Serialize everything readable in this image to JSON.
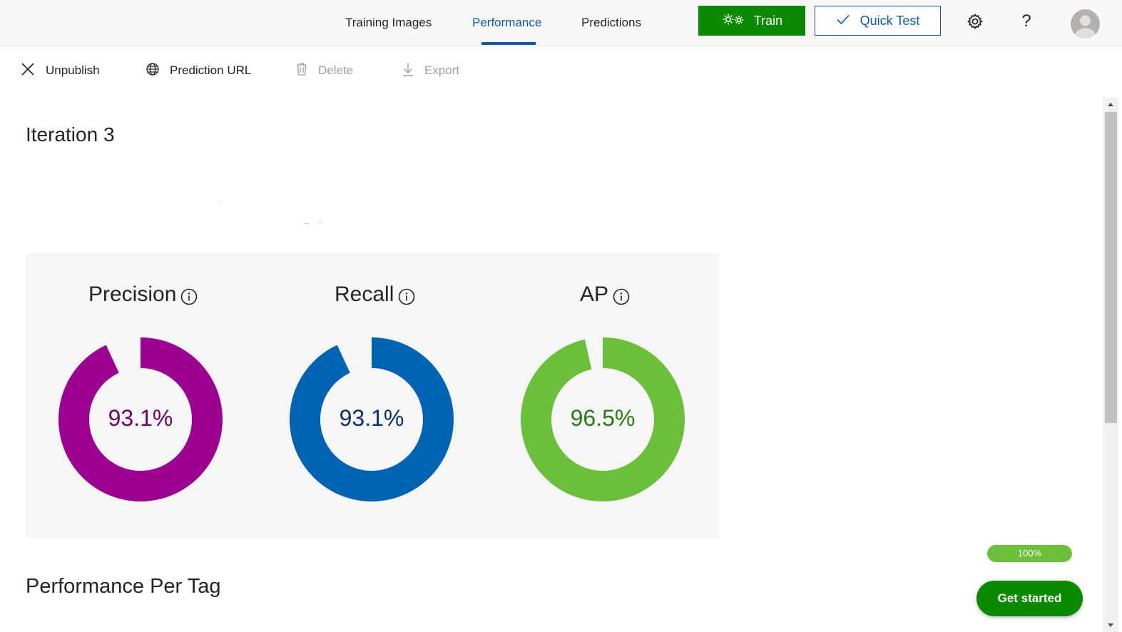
{
  "nav": {
    "tabs": [
      {
        "label": "Training Images"
      },
      {
        "label": "Performance",
        "active": true
      },
      {
        "label": "Predictions"
      }
    ],
    "train_label": "Train",
    "quick_test_label": "Quick Test",
    "help_label": "?"
  },
  "commands": {
    "unpublish": "Unpublish",
    "prediction_url": "Prediction URL",
    "delete": "Delete",
    "export": "Export"
  },
  "iteration_title": "Iteration 3",
  "metrics": [
    {
      "label": "Precision",
      "value": 93.1,
      "value_text": "93.1%",
      "color": "#9b0091",
      "text_color": "#6b0064"
    },
    {
      "label": "Recall",
      "value": 93.1,
      "value_text": "93.1%",
      "color": "#0063b1",
      "text_color": "#0d2d6b"
    },
    {
      "label": "AP",
      "value": 96.5,
      "value_text": "96.5%",
      "color": "#6bbf3a",
      "text_color": "#2b7a17"
    }
  ],
  "per_tag_title": "Performance Per Tag",
  "progress": {
    "value": 100,
    "label": "100%"
  },
  "get_started_label": "Get started",
  "colors": {
    "accent_blue": "#0f5aa6",
    "train_green": "#0b8a00",
    "panel_bg": "#f6f6f6"
  }
}
